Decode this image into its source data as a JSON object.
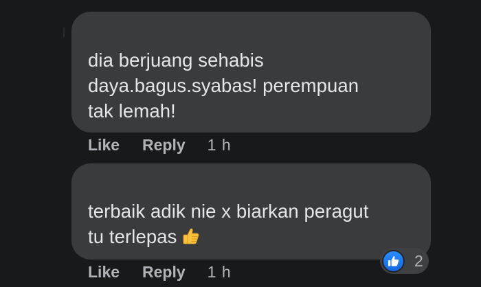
{
  "comments": [
    {
      "lines": [
        "dia berjuang sehabis",
        "daya.bagus.syabas! perempuan",
        "tak lemah!"
      ],
      "like_label": "Like",
      "reply_label": "Reply",
      "time": "1 h"
    },
    {
      "lines": [
        "terbaik adik nie x biarkan peragut",
        "tu terlepas"
      ],
      "emoji": "thumbs-up-emoji",
      "like_label": "Like",
      "reply_label": "Reply",
      "time": "1 h",
      "reactions": {
        "icon": "like-reaction-icon",
        "count": "2",
        "color": "#1877f2"
      }
    }
  ],
  "colors": {
    "background": "#18191a",
    "bubble": "#3a3b3c",
    "text": "#e4e6eb",
    "secondary_text": "#b0b3b8"
  }
}
